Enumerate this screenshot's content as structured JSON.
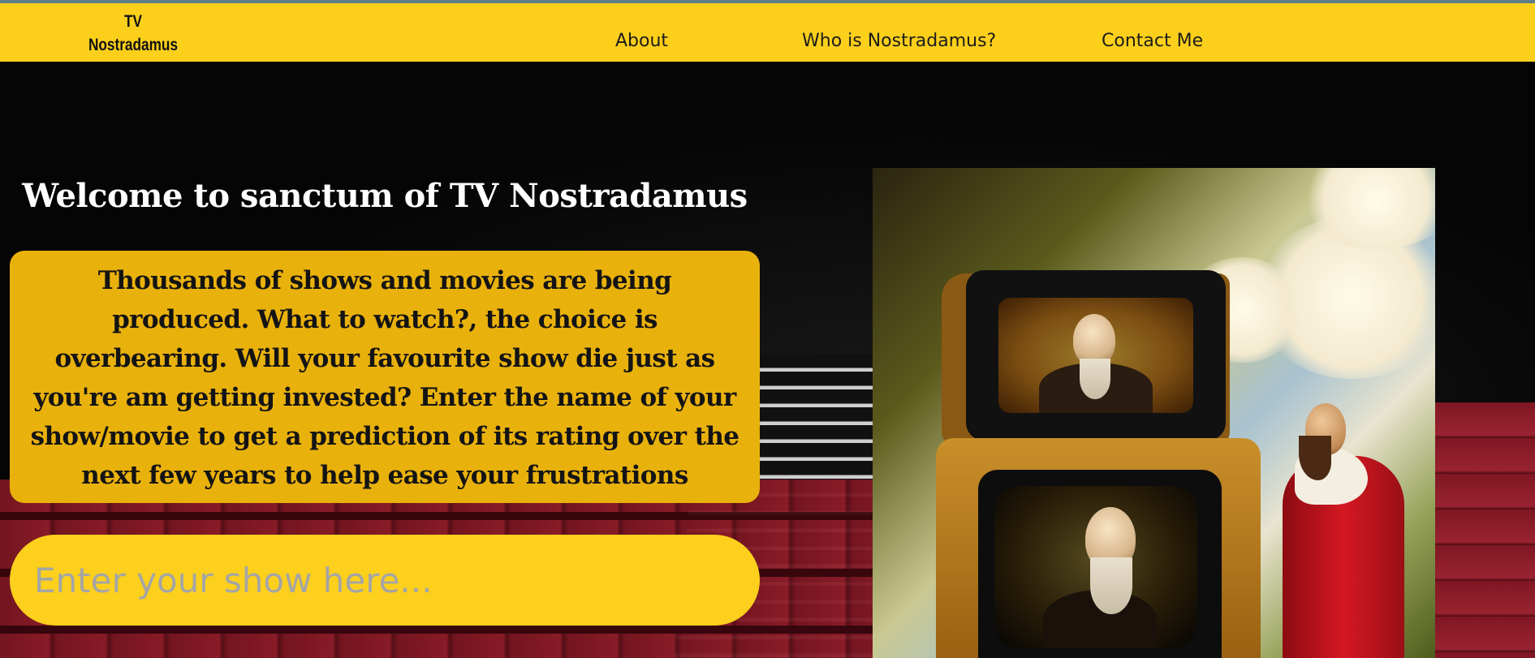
{
  "nav": {
    "logo_line1": "TV",
    "logo_line2": "Nostradamus",
    "links": [
      "About",
      "Who is Nostradamus?",
      "Contact Me"
    ]
  },
  "hero": {
    "title": "Welcome to sanctum of TV Nostradamus",
    "intro": "Thousands of shows and movies are being produced. What to watch?, the choice is overbearing. Will your favourite show die just as you're am getting invested? Enter the name of your show/movie to get a prediction of its rating over the next few years to help ease your frustrations"
  },
  "search": {
    "placeholder": "Enter your show here...",
    "value": ""
  },
  "colors": {
    "nav_bg": "#fccf1b",
    "intro_bg": "#e9b10c",
    "search_bg": "#fcd01c",
    "page_bg": "#050505"
  }
}
